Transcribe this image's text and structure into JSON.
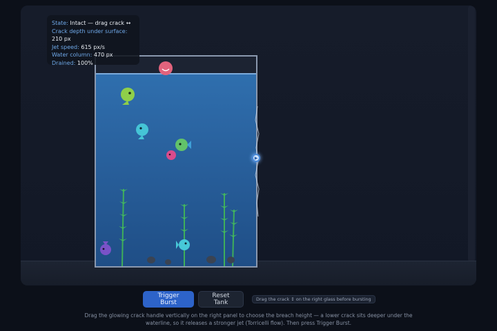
{
  "hud": {
    "state_key": "State:",
    "state_val": "Intact — drag crack ↔",
    "depth_key": "Crack depth under surface:",
    "depth_val": "210 px",
    "speed_key": "Jet speed:",
    "speed_val": "615 px/s",
    "column_key": "Water column:",
    "column_val": "470 px",
    "drained_key": "Drained:",
    "drained_val": "100%"
  },
  "controls": {
    "trigger_label": "Trigger Burst",
    "reset_label": "Reset Tank",
    "hint": "Drag the crack ↕ on the right glass before bursting"
  },
  "help_text": "Drag the glowing crack handle vertically on the right panel to choose the breach height — a lower crack sits deeper under the waterline, so it releases a stronger jet (Torricelli flow). Then press Trigger Burst.",
  "colors": {
    "accent": "#2d63c9",
    "water": "#2a63a0",
    "hud_key": "#6fa8e8"
  },
  "icons": {
    "crack_handle": "crack-handle-icon"
  }
}
